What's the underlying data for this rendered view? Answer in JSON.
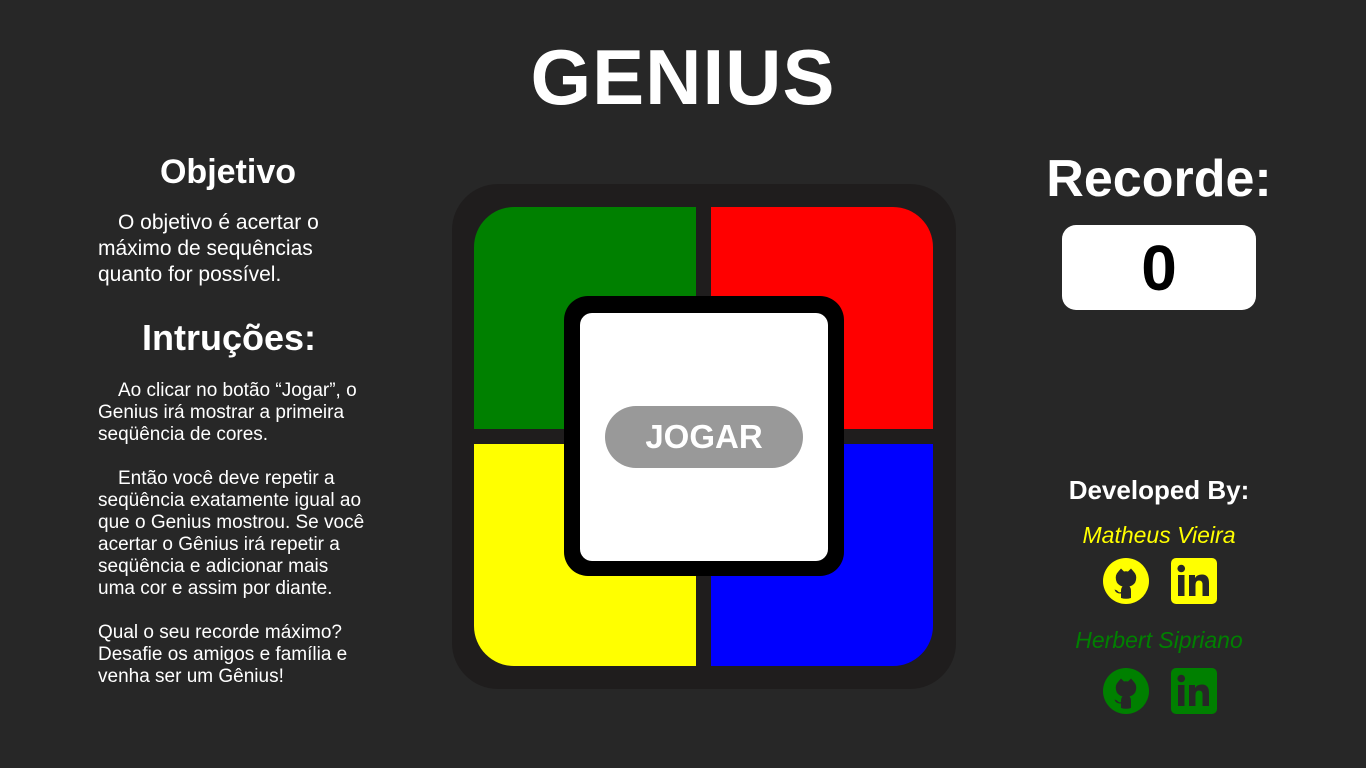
{
  "header": {
    "title": "GENIUS"
  },
  "objective": {
    "heading": "Objetivo",
    "text": "O objetivo é acertar o máximo de sequências quanto for possível."
  },
  "instructions": {
    "heading": "Intruções:",
    "paragraphs": [
      "Ao clicar no botão “Jogar”, o Genius irá mostrar a primeira seqüência de cores.",
      "Então você deve repetir a seqüência exatamente igual ao que o Genius mostrou. Se você acertar o Gênius irá repetir a seqüência e adicionar mais uma cor e assim por diante.",
      "Qual o seu recorde máximo? Desafie os amigos e família e venha ser um Gênius!"
    ]
  },
  "game": {
    "play_label": "JOGAR",
    "colors": {
      "green": "#008000",
      "red": "#ff0000",
      "yellow": "#ffff00",
      "blue": "#0000ff"
    }
  },
  "record": {
    "label": "Recorde:",
    "value": "0"
  },
  "developers": {
    "heading": "Developed By:",
    "people": [
      {
        "name": "Matheus Vieira",
        "color": "#ffff00",
        "icons": [
          "github-icon",
          "linkedin-icon"
        ]
      },
      {
        "name": "Herbert Sipriano",
        "color": "#008000",
        "icons": [
          "github-icon",
          "linkedin-icon"
        ]
      }
    ]
  }
}
